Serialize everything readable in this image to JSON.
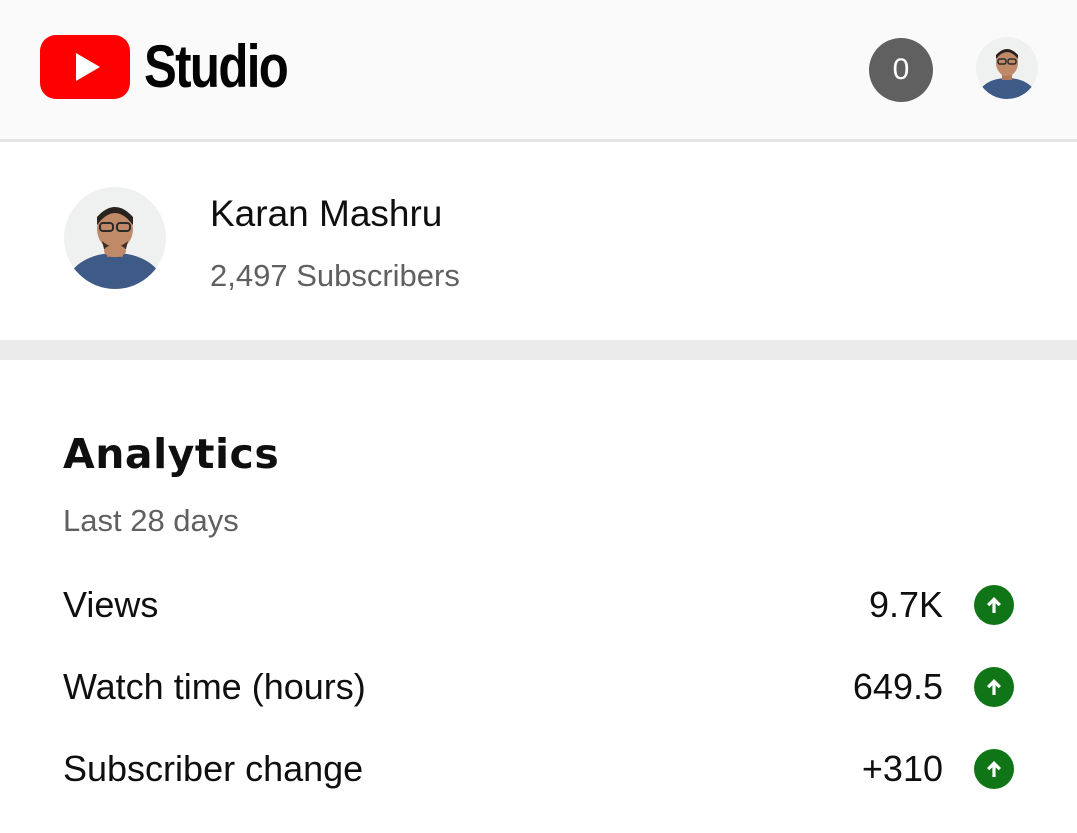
{
  "header": {
    "app_name": "Studio",
    "notification_count": "0",
    "logo_icon": "youtube-play-icon",
    "brand_color": "#ff0000"
  },
  "channel": {
    "name": "Karan Mashru",
    "subscribers": "2,497 Subscribers"
  },
  "analytics": {
    "title": "Analytics",
    "period": "Last 28 days",
    "metrics": [
      {
        "label": "Views",
        "value": "9.7K",
        "trend": "up",
        "trend_icon": "arrow-up-icon"
      },
      {
        "label": "Watch time (hours)",
        "value": "649.5",
        "trend": "up",
        "trend_icon": "arrow-up-icon"
      },
      {
        "label": "Subscriber change",
        "value": "+310",
        "trend": "up",
        "trend_icon": "arrow-up-icon"
      }
    ],
    "trend_color": "#107516"
  }
}
